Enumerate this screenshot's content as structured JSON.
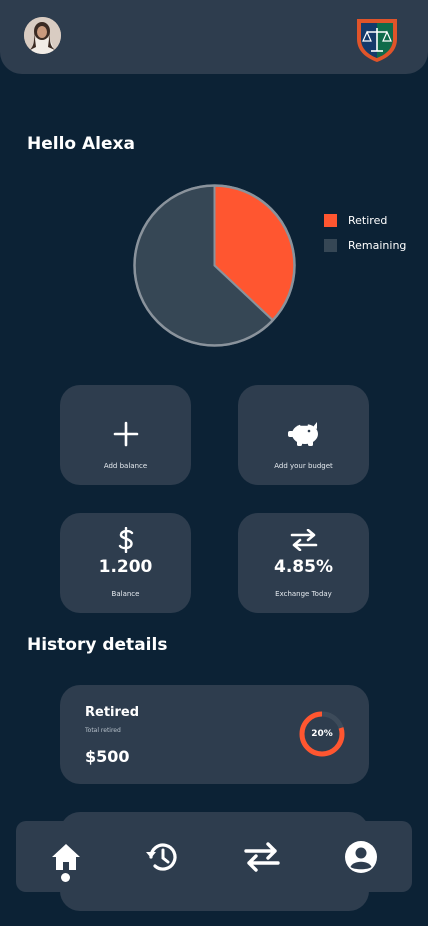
{
  "header": {
    "avatar_icon": "user-avatar-photo",
    "logo_icon": "justice-scales-shield-logo"
  },
  "greeting": "Hello Alexa",
  "chart_data": {
    "type": "pie",
    "labels": [
      "Retired",
      "Remaining"
    ],
    "values": [
      37,
      63
    ],
    "colors": [
      "#ff5630",
      "#364755"
    ],
    "legend_position": "right"
  },
  "legend": [
    {
      "label": "Retired",
      "color": "#ff5630"
    },
    {
      "label": "Remaining",
      "color": "#364755"
    }
  ],
  "actions": {
    "add_balance": {
      "label": "Add balance",
      "icon": "plus-icon"
    },
    "add_budget": {
      "label": "Add your budget",
      "icon": "piggy-bank-icon"
    },
    "balance": {
      "label": "Balance",
      "value": "1.200",
      "icon": "dollar-icon"
    },
    "exchange": {
      "label": "Exchange Today",
      "value": "4.85%",
      "icon": "exchange-arrows-icon"
    }
  },
  "history": {
    "title": "History details",
    "items": [
      {
        "title": "Retired",
        "subtitle": "Total retired",
        "amount": "$500",
        "percent_label": "20%",
        "percent": 0.2,
        "accent": "#ff5630"
      }
    ]
  },
  "nav": {
    "items": [
      {
        "name": "home",
        "icon": "home-icon",
        "active": true
      },
      {
        "name": "history",
        "icon": "history-icon",
        "active": false
      },
      {
        "name": "exchange",
        "icon": "exchange-arrows-icon",
        "active": false
      },
      {
        "name": "profile",
        "icon": "account-circle-icon",
        "active": false
      }
    ]
  },
  "colors": {
    "background": "#0c2235",
    "card": "#2e3d4e",
    "accent": "#ff5630"
  }
}
